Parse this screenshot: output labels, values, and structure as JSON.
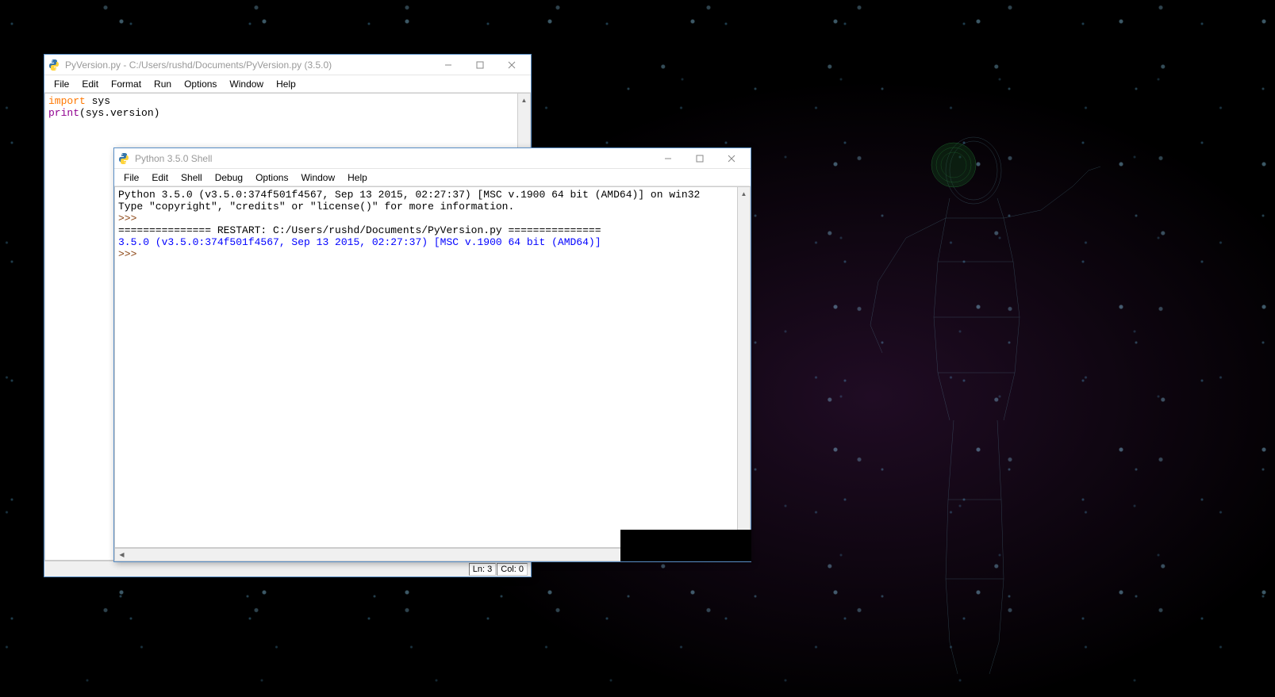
{
  "editor_window": {
    "title": "PyVersion.py - C:/Users/rushd/Documents/PyVersion.py (3.5.0)",
    "menus": [
      "File",
      "Edit",
      "Format",
      "Run",
      "Options",
      "Window",
      "Help"
    ],
    "code": {
      "line1_kw": "import",
      "line1_rest": " sys",
      "line2_builtin": "print",
      "line2_rest": "(sys.version)"
    },
    "status": {
      "ln": "Ln: 3",
      "col": "Col: 0"
    }
  },
  "shell_window": {
    "title": "Python 3.5.0 Shell",
    "menus": [
      "File",
      "Edit",
      "Shell",
      "Debug",
      "Options",
      "Window",
      "Help"
    ],
    "output": {
      "banner1": "Python 3.5.0 (v3.5.0:374f501f4567, Sep 13 2015, 02:27:37) [MSC v.1900 64 bit (AMD64)] on win32",
      "banner2": "Type \"copyright\", \"credits\" or \"license()\" for more information.",
      "prompt1": ">>> ",
      "restart": "=============== RESTART: C:/Users/rushd/Documents/PyVersion.py ===============",
      "result": "3.5.0 (v3.5.0:374f501f4567, Sep 13 2015, 02:27:37) [MSC v.1900 64 bit (AMD64)]",
      "prompt2": ">>> "
    }
  }
}
